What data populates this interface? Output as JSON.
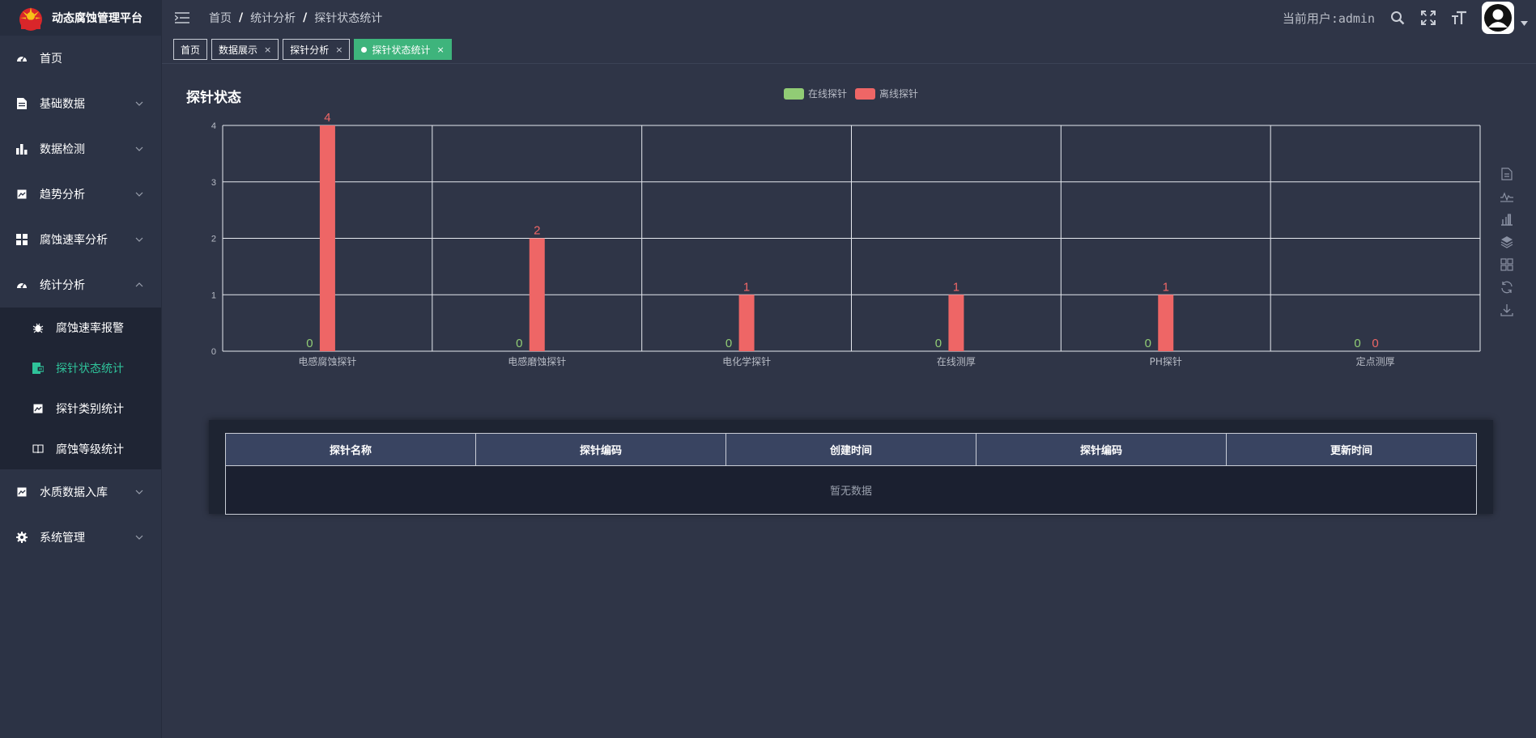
{
  "app": {
    "title": "动态腐蚀管理平台"
  },
  "sidebar": {
    "items": [
      {
        "label": "首页",
        "icon": "dashboard-icon"
      },
      {
        "label": "基础数据",
        "icon": "document-icon"
      },
      {
        "label": "数据检测",
        "icon": "bar-chart-icon"
      },
      {
        "label": "趋势分析",
        "icon": "image-icon"
      },
      {
        "label": "腐蚀速率分析",
        "icon": "grid-icon"
      },
      {
        "label": "统计分析",
        "icon": "dashboard-icon",
        "expanded": true
      },
      {
        "label": "水质数据入库",
        "icon": "image-icon"
      },
      {
        "label": "系统管理",
        "icon": "gear-icon"
      }
    ],
    "stats_children": [
      {
        "label": "腐蚀速率报警",
        "icon": "bug-icon"
      },
      {
        "label": "探针状态统计",
        "icon": "report-icon",
        "active": true
      },
      {
        "label": "探针类别统计",
        "icon": "image-icon"
      },
      {
        "label": "腐蚀等级统计",
        "icon": "book-icon"
      }
    ]
  },
  "header": {
    "breadcrumb": [
      "首页",
      "统计分析",
      "探针状态统计"
    ],
    "current_user": "当前用户:admin"
  },
  "tabs": [
    {
      "label": "首页",
      "closable": false
    },
    {
      "label": "数据展示",
      "closable": true
    },
    {
      "label": "探针分析",
      "closable": true
    },
    {
      "label": "探针状态统计",
      "closable": true,
      "active": true
    }
  ],
  "close_glyph": "×",
  "chart_data": {
    "type": "bar",
    "title": "探针状态",
    "categories": [
      "电感腐蚀探针",
      "电感磨蚀探针",
      "电化学探针",
      "在线测厚",
      "PH探针",
      "定点测厚"
    ],
    "series": [
      {
        "name": "在线探针",
        "color": "#91cc75",
        "values": [
          0,
          0,
          0,
          0,
          0,
          0
        ]
      },
      {
        "name": "离线探针",
        "color": "#ee6666",
        "values": [
          4,
          2,
          1,
          1,
          1,
          0
        ]
      }
    ],
    "ylim": [
      0,
      4
    ],
    "yticks": [
      "0",
      "1",
      "2",
      "3",
      "4"
    ],
    "grid": true,
    "legend_position": "top-center"
  },
  "table": {
    "columns": [
      "探针名称",
      "探针编码",
      "创建时间",
      "探针编码",
      "更新时间"
    ],
    "empty_text": "暂无数据"
  }
}
